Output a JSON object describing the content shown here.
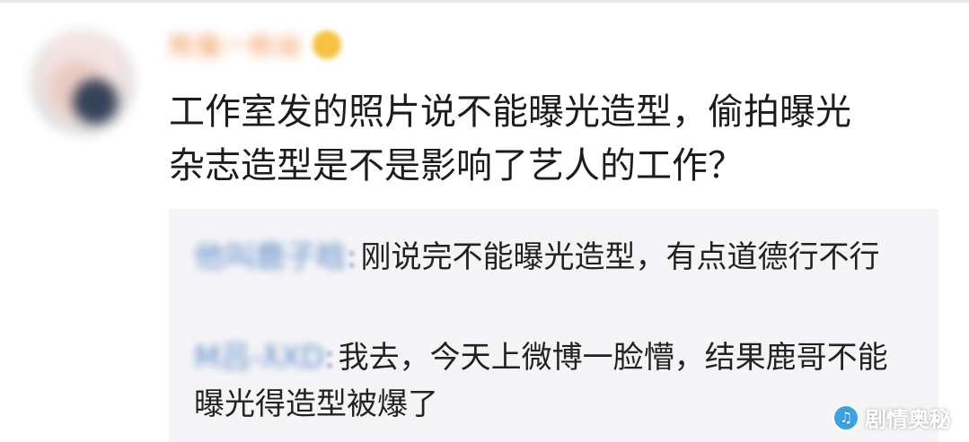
{
  "comment": {
    "username": "熊猫一粉丝",
    "text": "工作室发的照片说不能曝光造型，偷拍曝光\n杂志造型是不是影响了艺人的工作？"
  },
  "replies": [
    {
      "user": "他叫鹿子晗",
      "separator": ":",
      "text": "刚说完不能曝光造型，有点道德行不行"
    },
    {
      "user": "M吕-ƛXD",
      "separator": ":",
      "text": "我去，今天上微博一脸懵，结果鹿哥不能曝光得造型被爆了"
    }
  ],
  "watermark": {
    "text": "剧情奥秘"
  },
  "colors": {
    "username": "#f0914a",
    "reply_user": "#5b8ac9",
    "reply_bg": "#f5f5f7"
  }
}
